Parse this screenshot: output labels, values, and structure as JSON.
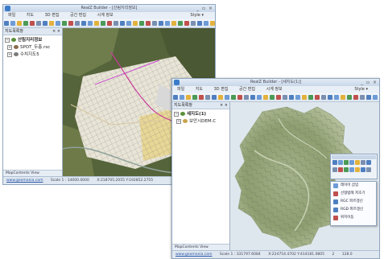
{
  "window1": {
    "title": "RealZ Builder - [산림지리정보]",
    "controls": "_ ▫ ×",
    "menu": [
      "파일",
      "지도",
      "3D 편집",
      "공간 편집",
      "시계 정보"
    ],
    "style_label": "Style ▾",
    "panel_title": "지도목록창",
    "panel_close": "× ×",
    "layers": [
      {
        "label": "산림지리정보",
        "expander": "−",
        "bold": true
      },
      {
        "label": "SPOT_두층.rsc",
        "expander": "+",
        "bold": false
      },
      {
        "label": "수치지도5",
        "expander": "+",
        "bold": false
      }
    ],
    "panel_tab": "MapContents View",
    "status": {
      "url": "www.geomania.com",
      "scale": "Scale 1 : 14000.0000",
      "coords": "X:218705.2055 Y:192852.2755"
    }
  },
  "window2": {
    "title": "RealZ Builder - [세지도(1)]",
    "controls": "_ ▫ ×",
    "menu": [
      "파일",
      "지도",
      "3D 편집",
      "공간 편집",
      "시계 정보"
    ],
    "style_label": "Style ▾",
    "panel_title": "지도목록창",
    "panel_close": "× ×",
    "layers": [
      {
        "label": "세지도(1)",
        "expander": "−",
        "bold": true
      },
      {
        "label": "보안시DEM.C",
        "expander": "+",
        "bold": false
      }
    ],
    "panel_tab": "MapContents View",
    "status": {
      "url": "www.geomania.com",
      "scale": "Scale 1 : 331797.6084",
      "coords": "X:224754.4702 Y:414181.0805",
      "page": "2",
      "zoom": "128.0"
    }
  },
  "context_menu": {
    "items": [
      "레이어 삽입",
      "선형범례 저초기",
      "RGC 파르갱신",
      "RGD 파르갱신",
      "위치이동"
    ]
  },
  "colors": {
    "title_bar": "#c7d6e8",
    "frame": "#8fa6bf",
    "terrain": "#8e9e70",
    "background": "#dfe7ee"
  }
}
